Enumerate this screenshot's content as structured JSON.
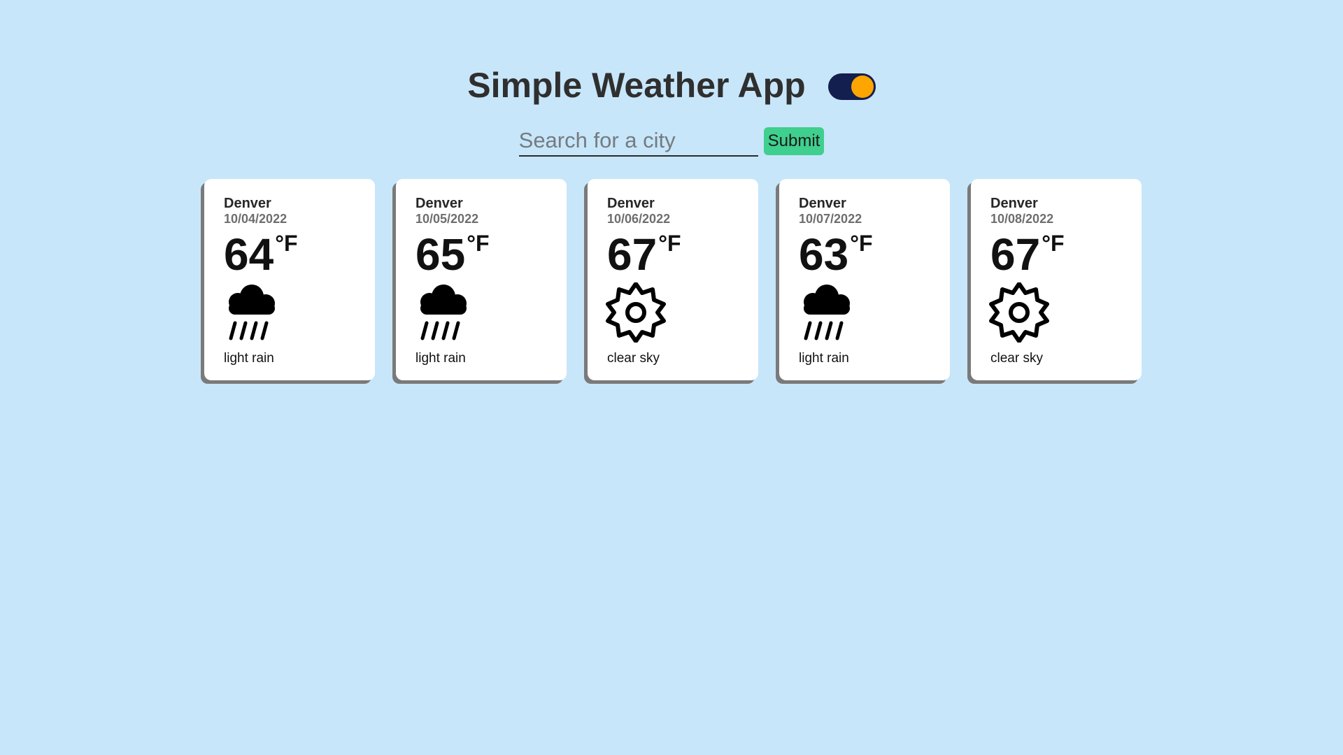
{
  "header": {
    "title": "Simple Weather App",
    "theme_toggle": {
      "on": true,
      "track_color": "#131f4f",
      "knob_color": "#ffa500"
    }
  },
  "search": {
    "placeholder": "Search for a city",
    "value": "",
    "submit_label": "Submit",
    "submit_color": "#3fcf8e"
  },
  "forecast": [
    {
      "city": "Denver",
      "date": "10/04/2022",
      "temp": "64",
      "unit": "°F",
      "icon": "rain-cloud-icon",
      "description": "light rain"
    },
    {
      "city": "Denver",
      "date": "10/05/2022",
      "temp": "65",
      "unit": "°F",
      "icon": "rain-cloud-icon",
      "description": "light rain"
    },
    {
      "city": "Denver",
      "date": "10/06/2022",
      "temp": "67",
      "unit": "°F",
      "icon": "sun-icon",
      "description": "clear sky"
    },
    {
      "city": "Denver",
      "date": "10/07/2022",
      "temp": "63",
      "unit": "°F",
      "icon": "rain-cloud-icon",
      "description": "light rain"
    },
    {
      "city": "Denver",
      "date": "10/08/2022",
      "temp": "67",
      "unit": "°F",
      "icon": "sun-icon",
      "description": "clear sky"
    }
  ],
  "colors": {
    "background": "#c7e6fa",
    "card": "#ffffff",
    "card_shadow": "#7a7a7a"
  }
}
